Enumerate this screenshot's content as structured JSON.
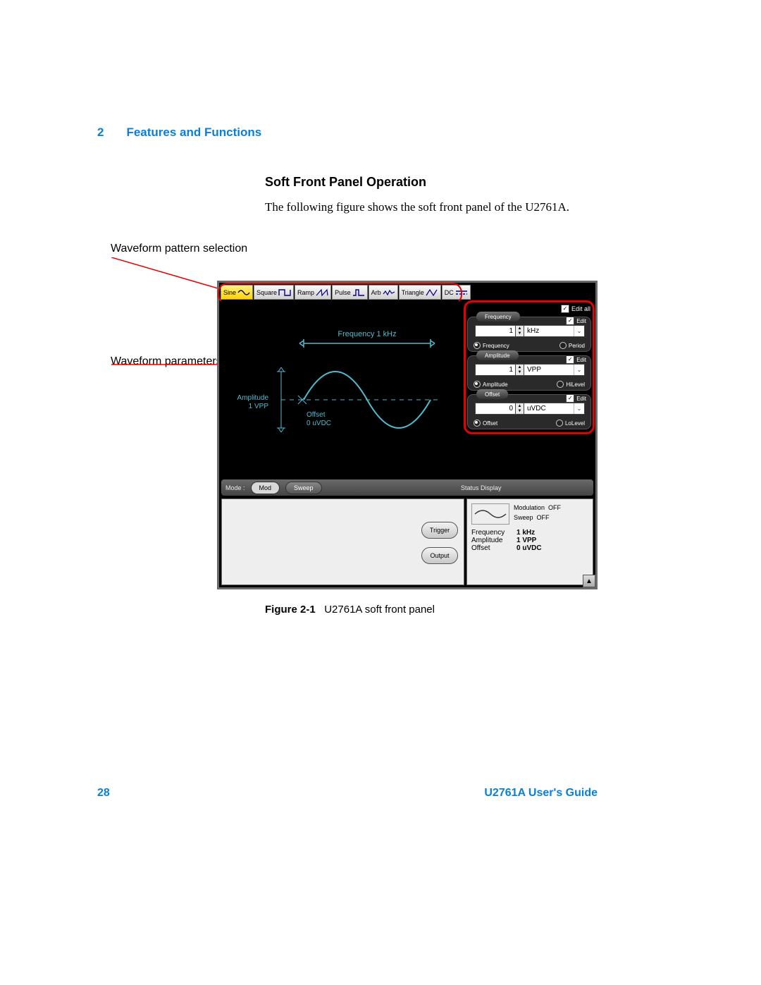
{
  "header": {
    "chapter_number": "2",
    "chapter_title": "Features and Functions"
  },
  "section_title": "Soft Front Panel Operation",
  "paragraph": "The following figure shows the soft front panel of the U2761A.",
  "callouts": {
    "pattern": "Waveform pattern selection",
    "params": "Waveform parameters"
  },
  "toolbar": {
    "buttons": [
      {
        "label": "Sine",
        "active": true
      },
      {
        "label": "Square",
        "active": false
      },
      {
        "label": "Ramp",
        "active": false
      },
      {
        "label": "Pulse",
        "active": false
      },
      {
        "label": "Arb",
        "active": false
      },
      {
        "label": "Triangle",
        "active": false
      },
      {
        "label": "DC",
        "active": false
      }
    ]
  },
  "display_labels": {
    "frequency": "Frequency 1 kHz",
    "amplitude_l1": "Amplitude",
    "amplitude_l2": "1 VPP",
    "offset_l1": "Offset",
    "offset_l2": "0 uVDC"
  },
  "params": {
    "edit_all": "Edit all",
    "groups": [
      {
        "title": "Frequency",
        "edit": "Edit",
        "value": "1",
        "unit": "kHz",
        "radio_left": "Frequency",
        "radio_right": "Period",
        "left_on": true
      },
      {
        "title": "Amplitude",
        "edit": "Edit",
        "value": "1",
        "unit": "VPP",
        "radio_left": "Amplitude",
        "radio_right": "HiLevel",
        "left_on": true
      },
      {
        "title": "Offset",
        "edit": "Edit",
        "value": "0",
        "unit": "uVDC",
        "radio_left": "Offset",
        "radio_right": "LoLevel",
        "left_on": true
      }
    ]
  },
  "mode": {
    "label": "Mode :",
    "mod": "Mod",
    "sweep": "Sweep"
  },
  "status_bar": {
    "label": "Status Display"
  },
  "lower_right": {
    "modulation_label": "Modulation",
    "modulation_val": "OFF",
    "sweep_label": "Sweep",
    "sweep_val": "OFF",
    "rows": [
      {
        "k": "Frequency",
        "v": "1 kHz"
      },
      {
        "k": "Amplitude",
        "v": "1 VPP"
      },
      {
        "k": "Offset",
        "v": "0 uVDC"
      }
    ]
  },
  "big_buttons": {
    "trigger": "Trigger",
    "output": "Output"
  },
  "caption": {
    "fig": "Figure 2-1",
    "text": "U2761A soft front panel"
  },
  "footer": {
    "page": "28",
    "guide": "U2761A User's Guide"
  }
}
